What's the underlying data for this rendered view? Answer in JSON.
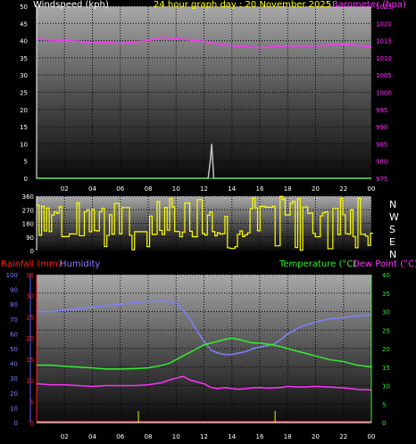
{
  "chart_data": [
    {
      "type": "line",
      "title": "24 hour graph day : 20 November 2025",
      "left_axis_label": "Windspeed (kph)",
      "right_axis_label": "Barometer (hpa)",
      "x_ticks": [
        "02",
        "04",
        "06",
        "08",
        "10",
        "12",
        "14",
        "16",
        "18",
        "20",
        "22",
        "00"
      ],
      "left_ticks": [
        "0",
        "5",
        "10",
        "15",
        "20",
        "25",
        "30",
        "35",
        "40",
        "45",
        "50"
      ],
      "right_ticks": [
        "975",
        "980",
        "985",
        "990",
        "995",
        "1000",
        "1005",
        "1010",
        "1015",
        "1020",
        "1025"
      ],
      "ylim_left": [
        0,
        50
      ],
      "ylim_right": [
        975,
        1025
      ],
      "colors": {
        "title": "#ffff00",
        "left_label": "#ffffff",
        "right_label": "#ff33ff",
        "pressure": "#ff33ff",
        "wind": "#c0c0c0",
        "gust": "#c0c0c0"
      },
      "series": [
        {
          "name": "Barometer (hpa)",
          "axis": "right",
          "x": [
            0,
            1,
            2,
            3,
            4,
            5,
            6,
            7,
            8,
            9,
            10,
            11,
            12,
            13,
            14,
            15,
            16,
            17,
            18,
            19,
            20,
            21,
            22,
            23,
            24
          ],
          "values": [
            1015.5,
            1015.2,
            1015.0,
            1014.8,
            1014.3,
            1014.5,
            1014.2,
            1014.6,
            1015.0,
            1016.0,
            1015.6,
            1015.2,
            1014.8,
            1014.0,
            1013.5,
            1013.2,
            1013.0,
            1013.2,
            1013.5,
            1013.4,
            1013.5,
            1013.8,
            1014.0,
            1013.6,
            1013.2
          ]
        },
        {
          "name": "Windspeed (kph)",
          "axis": "left",
          "x": [
            0,
            12.3,
            12.45,
            12.55,
            12.7,
            24
          ],
          "values": [
            0,
            0,
            5,
            10,
            0,
            0
          ]
        }
      ]
    },
    {
      "type": "scatter",
      "left_ticks": [
        "360",
        "270",
        "180",
        "90",
        "0"
      ],
      "direction_labels": [
        "N",
        "W",
        "S",
        "E",
        "N"
      ],
      "ylim": [
        0,
        360
      ],
      "colors": {
        "direction": "#ffff00",
        "labels": "#ffffff"
      }
    },
    {
      "type": "line",
      "labels": {
        "rain": "Rainfall (mm)",
        "humidity": "Humidity",
        "temperature": "Temperature (°C)",
        "dewpoint": "Dew Point (°C)"
      },
      "colors": {
        "rain": "#ff2020",
        "humidity": "#8080ff",
        "temperature": "#33ee33",
        "dewpoint": "#ff33ff",
        "x_axis": "#ffffff"
      },
      "x_ticks": [
        "02",
        "04",
        "06",
        "08",
        "10",
        "12",
        "14",
        "16",
        "18",
        "20",
        "22",
        "00"
      ],
      "humidity_ticks": [
        "0",
        "10",
        "20",
        "30",
        "40",
        "50",
        "60",
        "70",
        "80",
        "90",
        "100"
      ],
      "rain_ticks": [
        "0",
        "5",
        "10",
        "15",
        "20",
        "25",
        "30",
        "35"
      ],
      "temp_ticks": [
        "0",
        "5",
        "10",
        "15",
        "20",
        "25",
        "30",
        "35",
        "40"
      ],
      "ylim_humidity": [
        0,
        100
      ],
      "ylim_rain": [
        0,
        35
      ],
      "ylim_temp": [
        0,
        40
      ],
      "series": [
        {
          "name": "Humidity",
          "axis": "humidity",
          "x": [
            0,
            1,
            2,
            3,
            4,
            5,
            6,
            7,
            8,
            9,
            9.5,
            10,
            10.5,
            11,
            11.5,
            12,
            12.5,
            13,
            13.5,
            14,
            14.5,
            15,
            15.5,
            16,
            16.5,
            17,
            17.5,
            18,
            19,
            20,
            21,
            22,
            23,
            24
          ],
          "values": [
            75,
            75,
            76,
            77,
            78,
            79,
            80,
            81,
            82,
            82,
            82,
            81,
            76,
            70,
            62,
            55,
            49,
            47,
            46,
            46,
            47,
            48,
            50,
            51,
            52,
            53,
            56,
            60,
            65,
            68,
            70,
            71,
            72,
            73
          ]
        },
        {
          "name": "Temperature (°C)",
          "axis": "temp",
          "x": [
            0,
            1,
            2,
            3,
            4,
            5,
            6,
            7,
            8,
            9,
            9.5,
            10,
            10.5,
            11,
            11.5,
            12,
            12.5,
            13,
            13.5,
            14,
            14.5,
            15,
            15.5,
            16,
            16.5,
            17,
            17.5,
            18,
            19,
            20,
            21,
            22,
            23,
            24
          ],
          "values": [
            15.5,
            15.5,
            15.2,
            15.0,
            14.8,
            14.5,
            14.5,
            14.6,
            14.8,
            15.5,
            16,
            17,
            18,
            19,
            20,
            21,
            21.5,
            22,
            22.5,
            22.8,
            22.5,
            22,
            21.5,
            21.5,
            21.2,
            21,
            20.5,
            20,
            19,
            18,
            17,
            16.5,
            15.5,
            15
          ]
        },
        {
          "name": "Dew Point (°C)",
          "axis": "temp",
          "x": [
            0,
            1,
            2,
            3,
            4,
            5,
            6,
            7,
            8,
            9,
            9.5,
            10,
            10.5,
            11,
            11.5,
            12,
            12.5,
            13,
            13.5,
            14,
            14.5,
            15,
            15.5,
            16,
            16.5,
            17,
            17.5,
            18,
            19,
            20,
            21,
            22,
            23,
            24
          ],
          "values": [
            10.5,
            10.2,
            10.2,
            10.0,
            9.8,
            10.0,
            10.0,
            10.0,
            10.2,
            10.8,
            11.5,
            12,
            12.5,
            11.5,
            11,
            10.5,
            9.5,
            9.2,
            9.5,
            9.2,
            9.0,
            9.2,
            9.4,
            9.5,
            9.3,
            9.4,
            9.5,
            9.8,
            9.6,
            9.8,
            9.6,
            9.4,
            9.0,
            8.8
          ]
        },
        {
          "name": "Rainfall (mm)",
          "axis": "rain",
          "x": [
            0,
            24
          ],
          "values": [
            0,
            0
          ]
        }
      ],
      "rain_markers_x": [
        7.3,
        17.1
      ]
    }
  ]
}
